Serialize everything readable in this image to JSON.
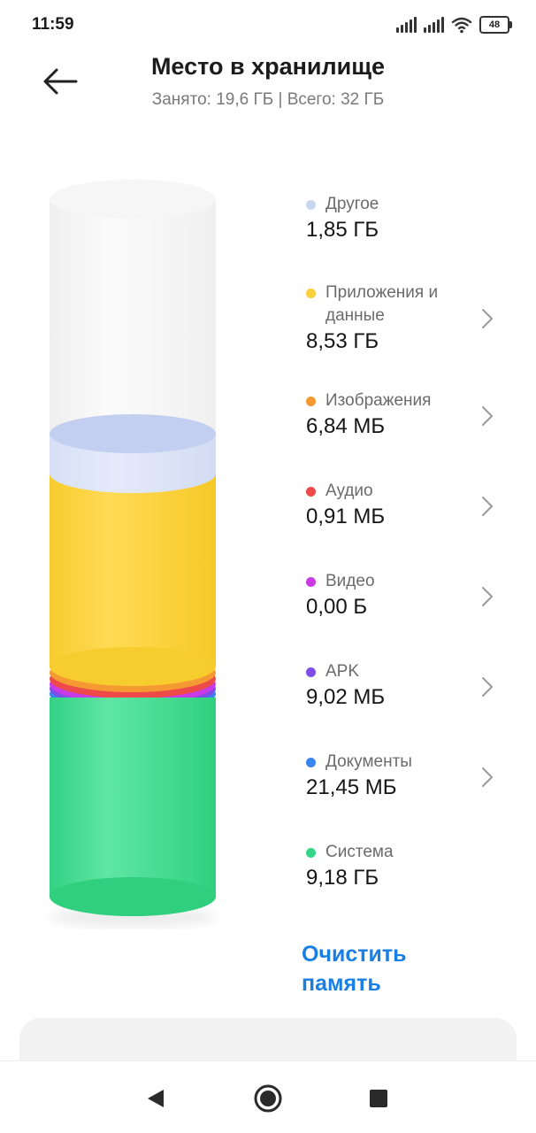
{
  "status_bar": {
    "time": "11:59",
    "battery": "48"
  },
  "header": {
    "title": "Место в хранилище",
    "subtitle": "Занято: 19,6 ГБ | Всего: 32 ГБ"
  },
  "categories": [
    {
      "label": "Другое",
      "value": "1,85 ГБ",
      "color": "#c9d6f2",
      "has_chevron": false
    },
    {
      "label": "Приложения и данные",
      "value": "8,53 ГБ",
      "color": "#f9cf3a",
      "has_chevron": true
    },
    {
      "label": "Изображения",
      "value": "6,84 МБ",
      "color": "#f59a32",
      "has_chevron": true
    },
    {
      "label": "Аудио",
      "value": "0,91 МБ",
      "color": "#ef4a4a",
      "has_chevron": true
    },
    {
      "label": "Видео",
      "value": "0,00 Б",
      "color": "#c83be6",
      "has_chevron": true
    },
    {
      "label": "APK",
      "value": "9,02 МБ",
      "color": "#7d4de8",
      "has_chevron": true
    },
    {
      "label": "Документы",
      "value": "21,45 МБ",
      "color": "#3a84ee",
      "has_chevron": true
    },
    {
      "label": "Система",
      "value": "9,18 ГБ",
      "color": "#34d589",
      "has_chevron": false
    }
  ],
  "actions": {
    "clear_memory": "Очистить память"
  },
  "icons": {
    "back": "arrow-left-icon",
    "chevron": "chevron-right-icon",
    "nav_back": "triangle-back-icon",
    "nav_home": "circle-home-icon",
    "nav_recents": "square-recents-icon"
  }
}
